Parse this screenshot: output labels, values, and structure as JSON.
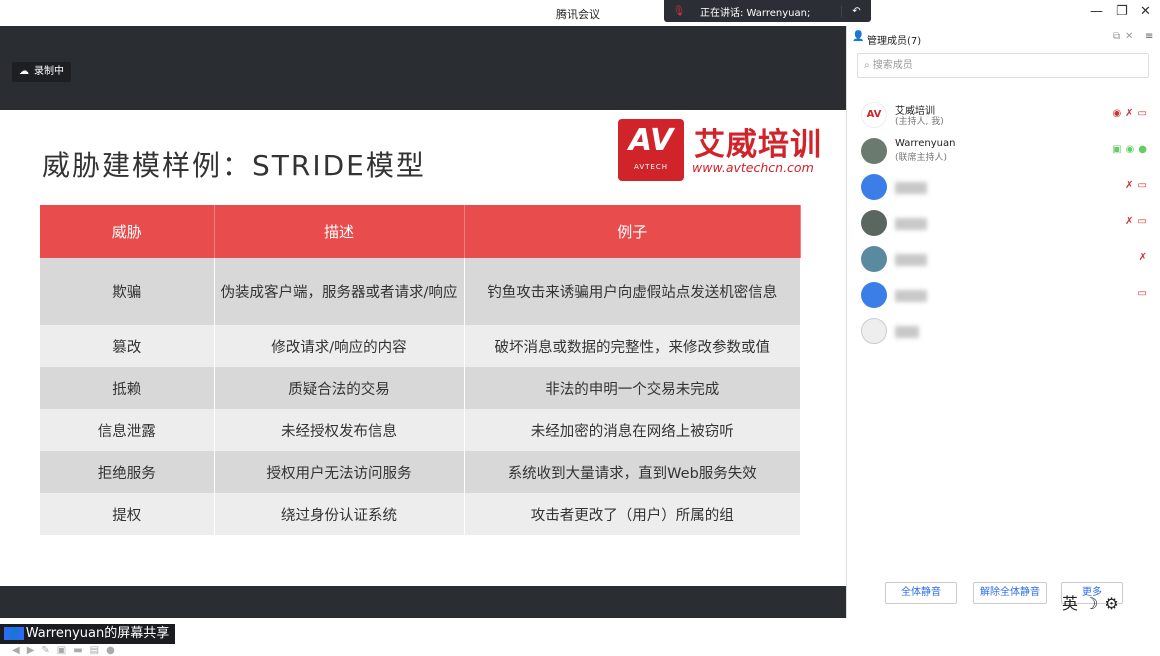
{
  "window": {
    "title": "腾讯会议",
    "min": "—",
    "restore": "❐",
    "close": "✕"
  },
  "speaking": {
    "text": "正在讲话: Warrenyuan;"
  },
  "recording": {
    "label": "录制中"
  },
  "slide": {
    "title": "威胁建模样例：STRIDE模型",
    "logo": {
      "mark": "AV",
      "mark_sub": "AVTECH",
      "name": "艾威培训",
      "url": "www.avtechcn.com"
    },
    "table": {
      "headers": [
        "威胁",
        "描述",
        "例子"
      ],
      "rows": [
        [
          "欺骗",
          "伪装成客户端，服务器或者请求/响应",
          "钓鱼攻击来诱骗用户向虚假站点发送机密信息"
        ],
        [
          "篡改",
          "修改请求/响应的内容",
          "破坏消息或数据的完整性，来修改参数或值"
        ],
        [
          "抵赖",
          "质疑合法的交易",
          "非法的申明一个交易未完成"
        ],
        [
          "信息泄露",
          "未经授权发布信息",
          "未经加密的消息在网络上被窃听"
        ],
        [
          "拒绝服务",
          "授权用户无法访问服务",
          "系统收到大量请求，直到Web服务失效"
        ],
        [
          "提权",
          "绕过身份认证系统",
          "攻击者更改了（用户）所属的组"
        ]
      ]
    }
  },
  "share_bar": {
    "label": "Warrenyuan的屏幕共享"
  },
  "panel": {
    "title": "管理成员(7)",
    "search_placeholder": "搜索成员",
    "members": [
      {
        "name": "艾威培训",
        "role": "(主持人, 我)"
      },
      {
        "name": "Warrenyuan",
        "role": "(联席主持人)"
      }
    ],
    "mute_all": "全体静音",
    "unmute_all": "解除全体静音",
    "more": "更多"
  },
  "ime": {
    "lang": "英"
  },
  "colors": {
    "accent": "#e84c4c",
    "brand": "#d0232a",
    "link": "#2a6cf0"
  }
}
